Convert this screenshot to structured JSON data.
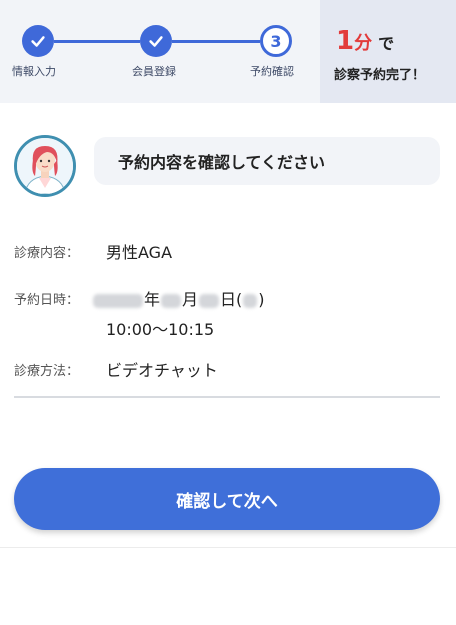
{
  "stepper": {
    "steps": [
      {
        "label": "情報入力",
        "state": "done"
      },
      {
        "label": "会員登録",
        "state": "done"
      },
      {
        "label": "予約確認",
        "state": "current",
        "number": "3"
      }
    ]
  },
  "promo": {
    "number": "1",
    "unit": "分",
    "particle": "で",
    "line2": "診察予約完了！"
  },
  "message": {
    "text": "予約内容を確認してください"
  },
  "details": {
    "content_label": "診療内容：",
    "content_value": "男性AGA",
    "datetime_label": "予約日時：",
    "year_suffix": "年",
    "month_suffix": "月",
    "day_suffix": "日(",
    "close_paren": ")",
    "time": "10:00〜10:15",
    "method_label": "診療方法：",
    "method_value": "ビデオチャット"
  },
  "actions": {
    "next_label": "確認して次へ"
  },
  "colors": {
    "primary": "#3f69d9",
    "button": "#3f6fd9",
    "promo_red": "#e23b3b",
    "header_bg": "#f2f4f8",
    "promo_bg": "#e4e8f2"
  }
}
